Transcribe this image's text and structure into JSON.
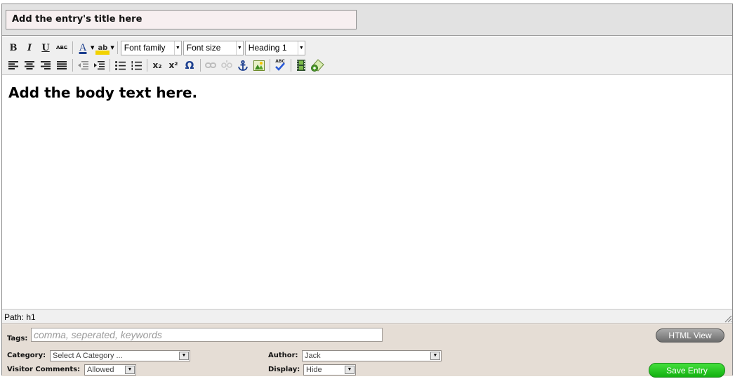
{
  "entry": {
    "title_value": "Add the entry's title here",
    "body_text": "Add the body text here."
  },
  "toolbar": {
    "bold_label": "B",
    "italic_label": "I",
    "underline_label": "U",
    "strike_label": "ABC",
    "forecolor_label": "A",
    "highlight_label": "ab",
    "font_family": "Font family",
    "font_size": "Font size",
    "format": "Heading 1",
    "subscript_label": "x₂",
    "superscript_label": "x²",
    "charmap_label": "Ω",
    "spellcheck_label": "ABC"
  },
  "statusbar": {
    "path": "Path: h1"
  },
  "meta": {
    "tags_label": "Tags:",
    "tags_placeholder": "comma, seperated, keywords",
    "category_label": "Category:",
    "category_value": "Select A Category ...",
    "author_label": "Author:",
    "author_value": "Jack",
    "comments_label": "Visitor Comments:",
    "comments_value": "Allowed",
    "display_label": "Display:",
    "display_value": "Hide"
  },
  "buttons": {
    "html_view": "HTML View",
    "save_entry": "Save Entry"
  },
  "colors": {
    "title_bar": "#e2e2e2",
    "toolbar": "#efefef",
    "meta_panel": "#e5ddd5",
    "save_green": "#22c41c",
    "html_view_gray": "#8a8a8a"
  }
}
